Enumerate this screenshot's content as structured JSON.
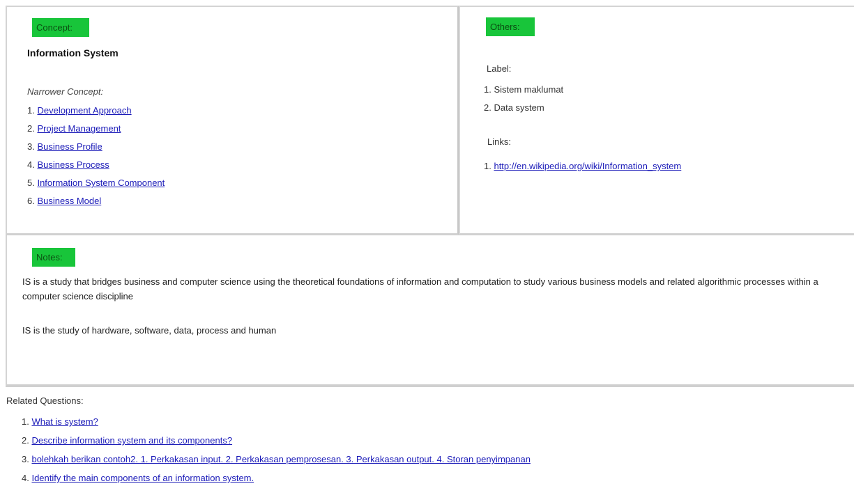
{
  "concept": {
    "tag": "Concept:",
    "title": "Information System",
    "narrower_label": "Narrower Concept:",
    "narrower": [
      {
        "num": "1.",
        "label": "Development Approach"
      },
      {
        "num": "2.",
        "label": "Project Management"
      },
      {
        "num": "3.",
        "label": "Business Profile"
      },
      {
        "num": "4.",
        "label": "Business Process"
      },
      {
        "num": "5.",
        "label": "Information System Component"
      },
      {
        "num": "6.",
        "label": "Business Model"
      }
    ]
  },
  "others": {
    "tag": "Others:",
    "label_heading": "Label:",
    "labels": [
      {
        "num": "1.",
        "label": "Sistem maklumat"
      },
      {
        "num": "2.",
        "label": "Data system"
      }
    ],
    "links_heading": "Links:",
    "links": [
      {
        "num": "1.",
        "label": "http://en.wikipedia.org/wiki/Information_system"
      }
    ]
  },
  "notes": {
    "tag": "Notes:",
    "paragraphs": [
      "IS is a study that bridges business and computer science using the theoretical foundations of information and computation to study various business models and related algorithmic processes within a computer science discipline",
      "IS is the study of hardware, software, data, process and human"
    ]
  },
  "related": {
    "heading": "Related Questions:",
    "questions": [
      {
        "num": "1.",
        "label": "What is system?"
      },
      {
        "num": "2.",
        "label": "Describe information system and its components?"
      },
      {
        "num": "3.",
        "label": "bolehkah berikan contoh2. 1. Perkakasan input. 2. Perkakasan pemprosesan. 3. Perkakasan output. 4. Storan penyimpanan"
      },
      {
        "num": "4.",
        "label": "Identify the main components of an information system."
      }
    ]
  },
  "colors": {
    "tag_green": "#18c53a",
    "link_blue": "#1a1ab8"
  }
}
